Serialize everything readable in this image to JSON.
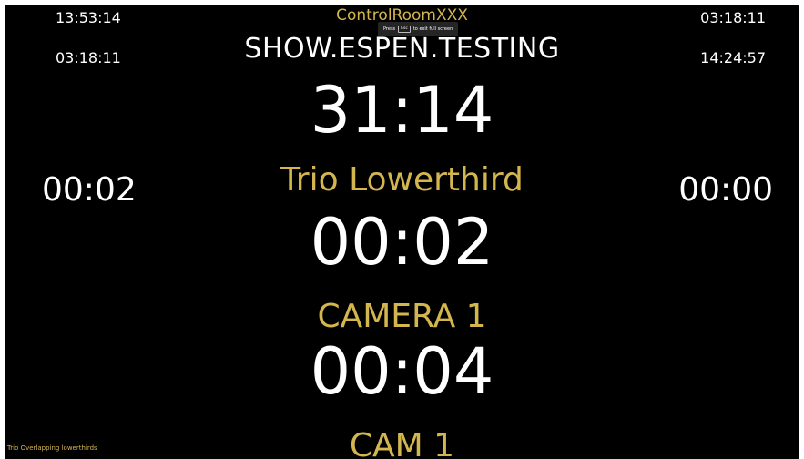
{
  "clocks": {
    "top_left": "13:53:14",
    "mid_left": "03:18:11",
    "top_right": "03:18:11",
    "mid_right": "14:24:57"
  },
  "control_room": "ControlRoomXXX",
  "fullscreen_notice": {
    "press": "Press",
    "key": "Esc",
    "suffix": "to exit full screen"
  },
  "show_name": "SHOW.ESPEN.TESTING",
  "main_timer": "31:14",
  "side_timers": {
    "left": "00:02",
    "right": "00:00"
  },
  "segments": [
    {
      "label": "Trio Lowerthird",
      "time": "00:02"
    },
    {
      "label": "CAMERA 1",
      "time": "00:04"
    },
    {
      "label": "CAM 1"
    }
  ],
  "footer_text": "Trio Overlapping lowerthirds",
  "colors": {
    "background": "#000000",
    "primary_text": "#ffffff",
    "accent_gold": "#d4b64f"
  }
}
